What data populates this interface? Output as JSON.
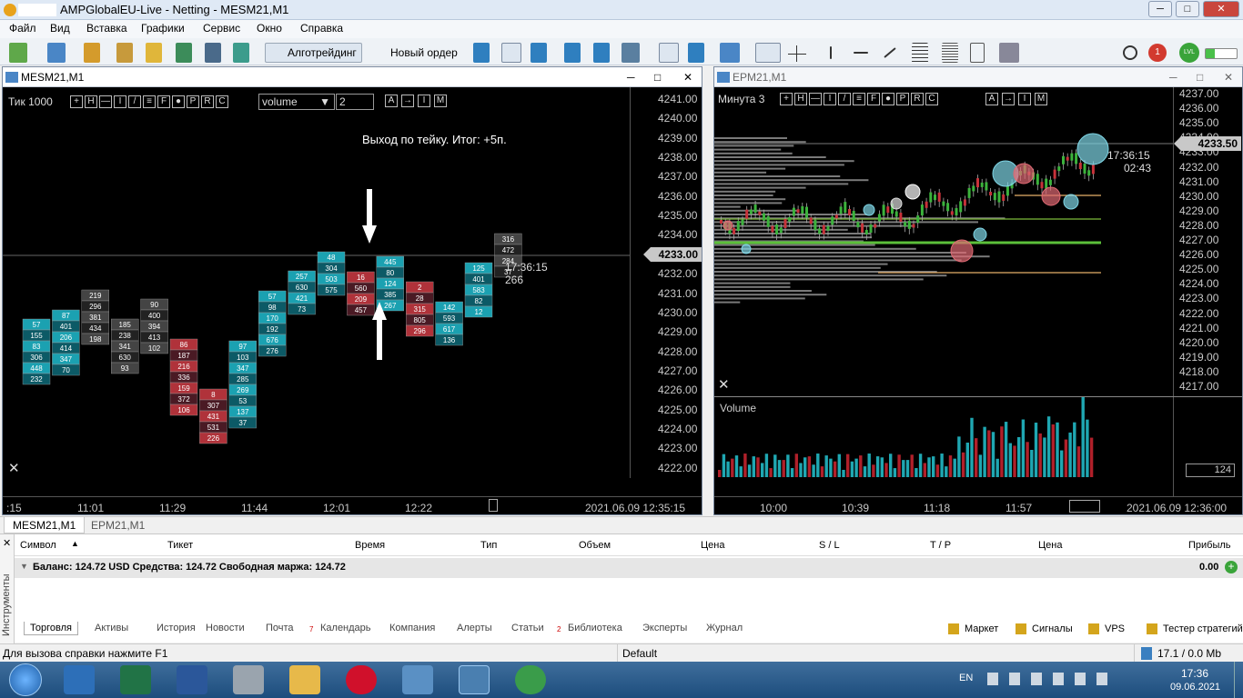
{
  "window": {
    "title": "AMPGlobalEU-Live - Netting - MESM21,M1",
    "min": "─",
    "max": "□",
    "close": "✕"
  },
  "menu": [
    "Файл",
    "Вид",
    "Вставка",
    "Графики",
    "Сервис",
    "Окно",
    "Справка"
  ],
  "toolbar": {
    "algo": "Алготрейдинг",
    "neworder": "Новый ордер",
    "notif": "1",
    "lvl": "LVL"
  },
  "left_chart": {
    "title": "MESM21,M1",
    "tf": "Тик  1000",
    "tool_letters": [
      "+",
      "H",
      "—",
      "I",
      "/",
      "≡",
      "F",
      "●",
      "P",
      "R",
      "C"
    ],
    "dropdown": "volume",
    "spin": "2",
    "annotation": "Выход по тейку. Итог: +5п.",
    "price_labels": [
      "4241.00",
      "4240.00",
      "4239.00",
      "4238.00",
      "4237.00",
      "4236.00",
      "4235.00",
      "4234.00",
      "4233.00",
      "4232.00",
      "4231.00",
      "4230.00",
      "4229.00",
      "4228.00",
      "4227.00",
      "4226.00",
      "4225.00",
      "4224.00",
      "4223.00",
      "4222.00"
    ],
    "current_price": "4233.00",
    "clock": "17:36:15",
    "tick_count": "266",
    "time_labels": [
      ":15",
      "11:01",
      "11:29",
      "11:44",
      "12:01",
      "12:22"
    ],
    "footer_time": "2021.06.09 12:35:15",
    "candles": [
      {
        "nums": [
          "57",
          "155",
          "83",
          "306",
          "448",
          "232"
        ],
        "c": "teal"
      },
      {
        "nums": [
          "87",
          "401",
          "206",
          "414",
          "347",
          "70"
        ],
        "c": "teal"
      },
      {
        "nums": [
          "219",
          "296",
          "381",
          "434",
          "198"
        ],
        "c": "dark"
      },
      {
        "nums": [
          "185",
          "238",
          "341",
          "630",
          "93"
        ],
        "c": "dark"
      },
      {
        "nums": [
          "90",
          "400",
          "394",
          "413",
          "102"
        ],
        "c": "dark"
      },
      {
        "nums": [
          "86",
          "187",
          "216",
          "336",
          "159",
          "372",
          "106"
        ],
        "c": "red"
      },
      {
        "nums": [
          "8",
          "307",
          "431",
          "531",
          "226"
        ],
        "c": "red"
      },
      {
        "nums": [
          "97",
          "103",
          "347",
          "285",
          "269",
          "53",
          "137",
          "37"
        ],
        "c": "teal"
      },
      {
        "nums": [
          "57",
          "98",
          "170",
          "192",
          "676",
          "276"
        ],
        "c": "teal"
      },
      {
        "nums": [
          "257",
          "630",
          "421",
          "73"
        ],
        "c": "teal"
      },
      {
        "nums": [
          "48",
          "304",
          "503",
          "575"
        ],
        "c": "teal"
      },
      {
        "nums": [
          "16",
          "560",
          "209",
          "457"
        ],
        "c": "red"
      },
      {
        "nums": [
          "445",
          "80",
          "124",
          "385",
          "267"
        ],
        "c": "teal"
      },
      {
        "nums": [
          "2",
          "28",
          "315",
          "805",
          "296"
        ],
        "c": "red"
      },
      {
        "nums": [
          "142",
          "593",
          "617",
          "136"
        ],
        "c": "teal"
      },
      {
        "nums": [
          "125",
          "401",
          "583",
          "82",
          "12"
        ],
        "c": "teal"
      },
      {
        "nums": [
          "316",
          "472",
          "284",
          "37"
        ],
        "c": "dark"
      }
    ]
  },
  "right_chart": {
    "title": "EPM21,M1",
    "tf": "Минута  3",
    "price_labels": [
      "4237.00",
      "4236.00",
      "4235.00",
      "4234.00",
      "4233.00",
      "4232.00",
      "4231.00",
      "4230.00",
      "4229.00",
      "4228.00",
      "4227.00",
      "4226.00",
      "4225.00",
      "4224.00",
      "4223.00",
      "4222.00",
      "4221.00",
      "4220.00",
      "4219.00",
      "4218.00",
      "4217.00"
    ],
    "current_price": "4233.50",
    "clock": "17:36:15",
    "countdown": "02:43",
    "volume_label": "Volume",
    "volume_value": "124",
    "time_labels": [
      "10:00",
      "10:39",
      "11:18",
      "11:57"
    ],
    "footer_time": "2021.06.09 12:36:00"
  },
  "chart_tabs": [
    "MESM21,M1",
    "EPM21,M1"
  ],
  "terminal": {
    "columns": [
      "Символ",
      "Тикет",
      "Время",
      "Тип",
      "Объем",
      "Цена",
      "S / L",
      "T / P",
      "Цена",
      "Прибыль"
    ],
    "balance": "Баланс: 124.72 USD  Средства: 124.72  Свободная маржа: 124.72",
    "profit": "0.00",
    "side_label": "Инструменты",
    "tabs": [
      "Торговля",
      "Активы",
      "История",
      "Новости",
      "Почта",
      "Календарь",
      "Компания",
      "Алерты",
      "Статьи",
      "Библиотека",
      "Эксперты",
      "Журнал"
    ],
    "mail_badge": "7",
    "articles_badge": "2",
    "right_links": [
      "Маркет",
      "Сигналы",
      "VPS",
      "Тестер стратегий"
    ]
  },
  "status": {
    "help": "Для вызова справки нажмите F1",
    "profile": "Default",
    "traffic": "17.1 / 0.0 Mb"
  },
  "tray": {
    "lang": "EN",
    "time": "17:36",
    "date": "09.06.2021"
  }
}
